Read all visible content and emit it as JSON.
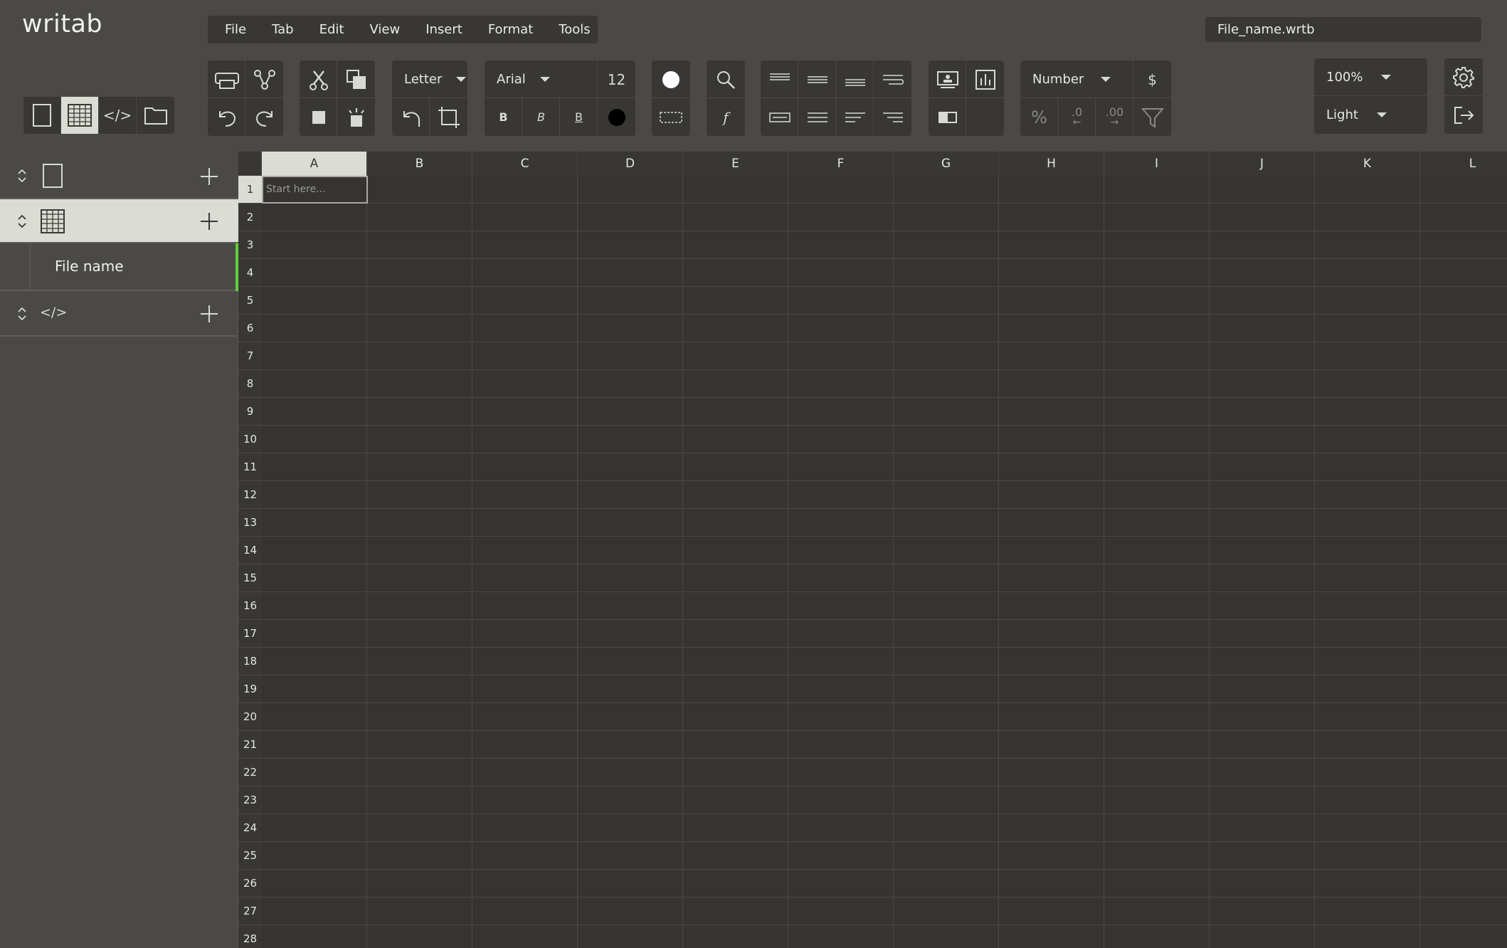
{
  "app": {
    "logo": "writab",
    "filename": "File_name.wrtb"
  },
  "menu": [
    "File",
    "Tab",
    "Edit",
    "View",
    "Insert",
    "Format",
    "Tools"
  ],
  "toolbar": {
    "page_size": "Letter",
    "font": "Arial",
    "font_size": "12",
    "bold": "B",
    "italic": "B",
    "underline": "B",
    "number_format": "Number",
    "currency": "$",
    "percent": "%",
    "decrease_decimals": ".0",
    "increase_decimals": ".00",
    "zoom": "100%",
    "theme": "Light",
    "function": "f"
  },
  "sidebar": {
    "sections": [
      {
        "type": "page",
        "icon": "page-icon"
      },
      {
        "type": "sheet",
        "icon": "grid-icon",
        "items": [
          "File name"
        ]
      },
      {
        "type": "code",
        "icon": "code-icon",
        "label": "</>"
      }
    ]
  },
  "view_switcher": [
    "page-icon",
    "grid-icon",
    "code-icon",
    "folder-icon"
  ],
  "view_switcher_code_label": "</>",
  "sheet": {
    "columns": [
      "A",
      "B",
      "C",
      "D",
      "E",
      "F",
      "G",
      "H",
      "I",
      "J",
      "K",
      "L"
    ],
    "rows": [
      "1",
      "2",
      "3",
      "4",
      "5",
      "6",
      "7",
      "8",
      "9",
      "10",
      "11",
      "12",
      "13",
      "14",
      "15",
      "16",
      "17",
      "18",
      "19",
      "20",
      "21",
      "22",
      "23",
      "24",
      "25",
      "26",
      "27",
      "28"
    ],
    "active_cell": "A1",
    "cell_placeholder": "Start here..."
  },
  "colors": {
    "background": "#4a4945",
    "panel": "#383734",
    "sheet": "#353431",
    "accent": "#5ed13a",
    "selected": "#dcdcd6"
  }
}
